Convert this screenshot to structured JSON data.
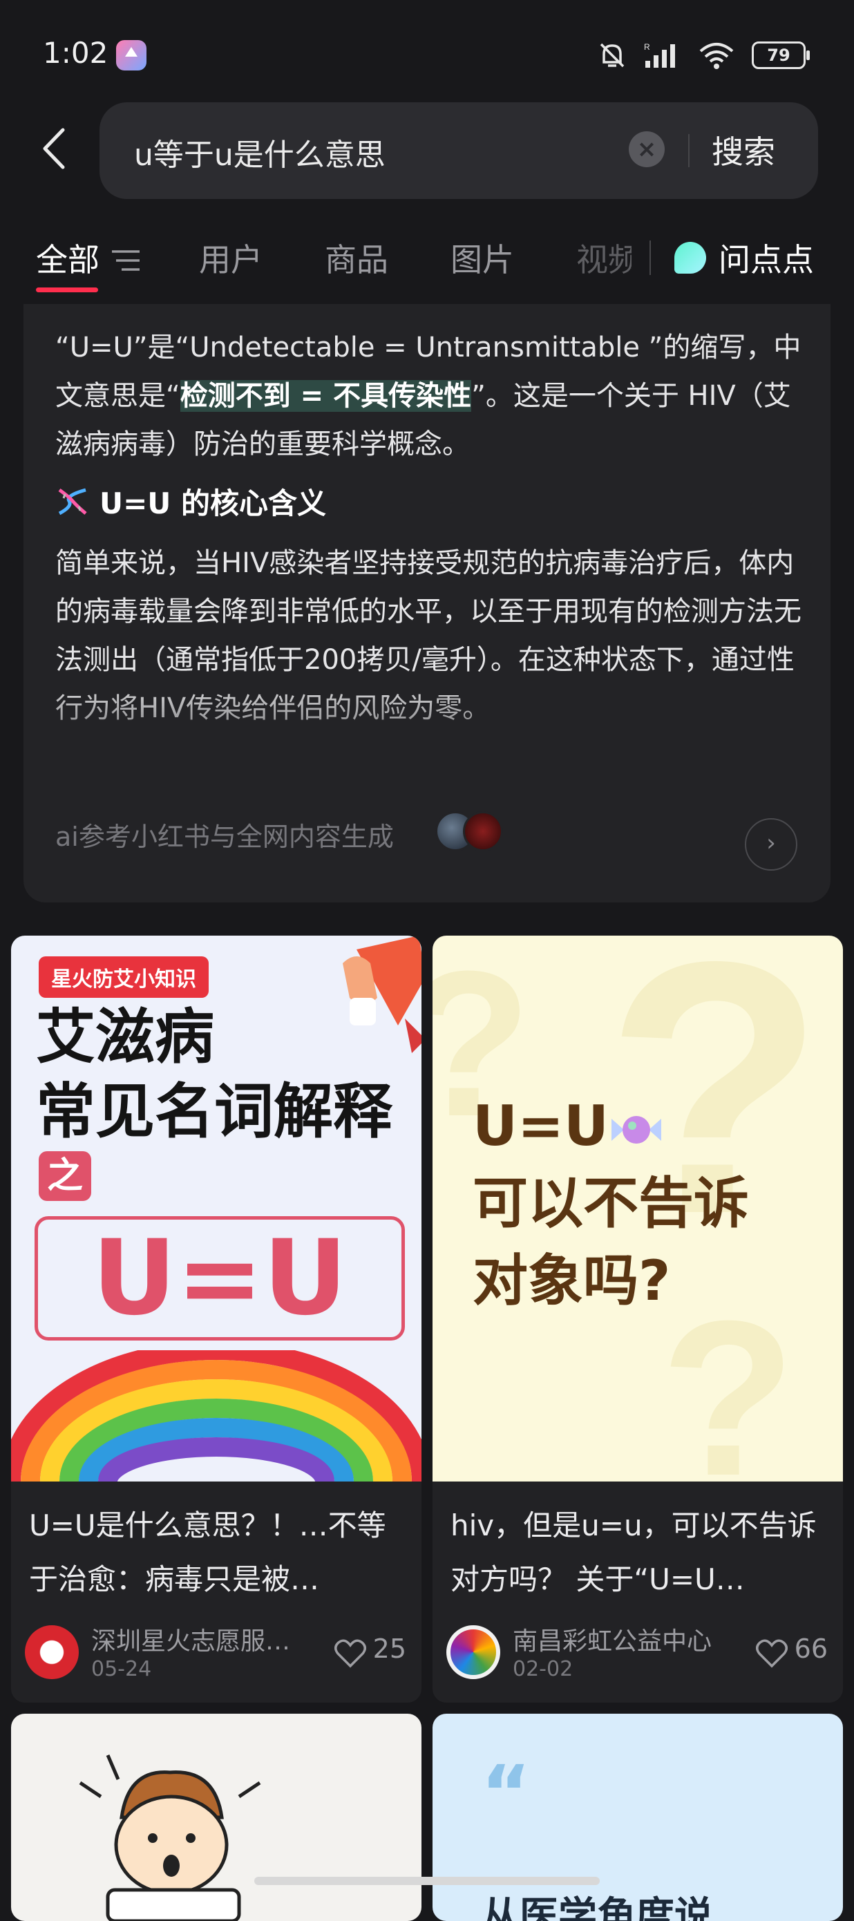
{
  "status_bar": {
    "time": "1:02",
    "battery": "79"
  },
  "search": {
    "query": "u等于u是什么意思",
    "button_label": "搜索"
  },
  "tabs": [
    {
      "label": "全部"
    },
    {
      "label": "用户"
    },
    {
      "label": "商品"
    },
    {
      "label": "图片"
    },
    {
      "label": "视频"
    },
    {
      "label": "问点点"
    }
  ],
  "ai_answer": {
    "para1_a": "“U=U”是“Undetectable = Untransmittable ”的缩写，中文意思是“",
    "para1_hl": "检测不到 = 不具传染性",
    "para1_b": "”。这是一个关于 HIV（艾滋病病毒）防治的重要科学概念。",
    "heading": "U=U 的核心含义",
    "para2": "简单来说，当HIV感染者坚持接受规范的抗病毒治疗后，体内的病毒载量会降到非常低的水平，以至于用现有的检测方法无法测出（通常指低于200拷贝/毫升）。在这种状态下，通过性行为将HIV传染给伴侣的风险为零。",
    "source": "ai参考小红书与全网内容生成"
  },
  "posts": [
    {
      "cover_tag": "星火防艾小知识",
      "cover_line1": "艾滋病",
      "cover_line2": "常见名词解释",
      "cover_zhi": "之",
      "cover_big": "U=U",
      "title": "U=U是什么意思？！…不等于治愈：病毒只是被…",
      "author": "深圳星火志愿服…",
      "date": "05-24",
      "likes": "25"
    },
    {
      "cover_line1": "U=U",
      "cover_line2": "可以不告诉",
      "cover_line3": "对象吗?",
      "title": "hiv，但是u=u，可以不告诉对方吗？ 关于“U=U…",
      "author": "南昌彩虹公益中心",
      "date": "02-02",
      "likes": "66"
    },
    {},
    {
      "cover_snippet": "从医学角度说"
    }
  ],
  "colors": {
    "accent": "#ff2e4d",
    "background": "#18181b"
  }
}
